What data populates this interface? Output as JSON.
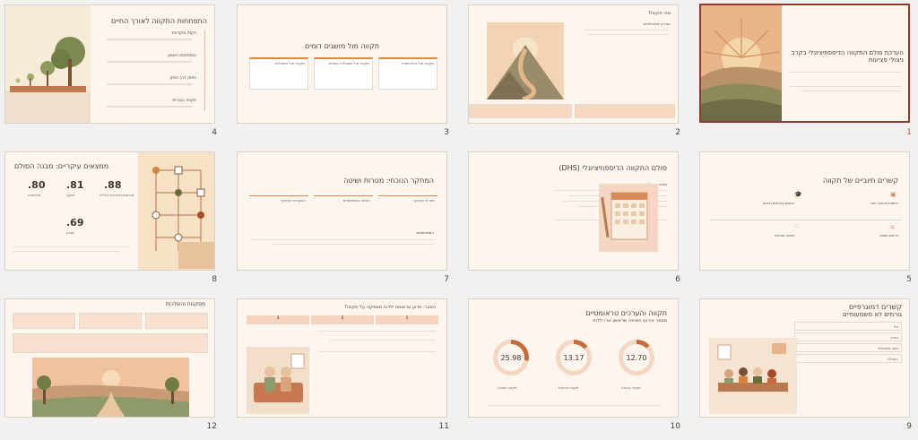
{
  "slides": [
    {
      "num": "1",
      "title": "הערכת סולם התקווה הדיספוזיציונלי בקרב ניצולי פציעות"
    },
    {
      "num": "2",
      "title": "מהי תקווה?",
      "sub": "הגדרה פסיכולוגית"
    },
    {
      "num": "3",
      "title": "תקווה מול מושגים דומים",
      "cards": [
        "תקווה מול אופטימיות",
        "תקווה מול מסוגלות עצמית",
        "תקווה מול משאלות"
      ]
    },
    {
      "num": "4",
      "title": "התפתחות התקווה לאורך החיים",
      "items": [
        "ינקות מוקדמת",
        "התפתחות האמון",
        "חיזוק דרך ניסיון",
        "תקווה בבגרות"
      ]
    },
    {
      "num": "5",
      "title": "קשרים חיוביים של תקווה",
      "items": [
        "התמודדות טובה יותר",
        "הישגים אקדמיים גבוהים",
        "בריאות נפשית",
        "תמיכה חברתית"
      ]
    },
    {
      "num": "6",
      "title": "סולם התקווה הדיספוזיציונלי (DHS)",
      "sub": "מבנה השאלון"
    },
    {
      "num": "7",
      "title": "המחקר הנוכחי: מטרות ושיטה",
      "cards": [
        "מטרת המחקר",
        "הנחת המשתתפים",
        "השערות המחקר"
      ],
      "sub": "המשתתפים"
    },
    {
      "num": "8",
      "title": "ממצאים עיקריים: מבנה הסולם",
      "stats": [
        {
          "v": ".80",
          "l": "מהימנות"
        },
        {
          "v": ".81",
          "l": "תוקף"
        },
        {
          "v": ".88",
          "l": "מהימנות פנימית כוללת"
        },
        {
          "v": ".69",
          "l": "מבחן"
        }
      ]
    },
    {
      "num": "9",
      "title": "קשרים דמוגרפיים",
      "sub": "גורמים לא משמעותיים",
      "items": [
        "גיל",
        "מגדר",
        "מצב משפחתי",
        "השכלה"
      ]
    },
    {
      "num": "10",
      "title": "תקווה והערכים טראומטיים",
      "sub": "מספר אירועי חשיפה שראשון שרו ילדות",
      "donuts": [
        {
          "v": "25.98",
          "l": "תקווה נמוכה"
        },
        {
          "v": "13.17",
          "l": "תקווה בינונית"
        },
        {
          "v": "12.70",
          "l": "תקווה גבוהה"
        }
      ]
    },
    {
      "num": "11",
      "title": "הסבר: מדוע טראומת ילדות משפיעה על תקווה?",
      "steps": [
        "1",
        "2",
        "3"
      ]
    },
    {
      "num": "12",
      "title": "מסקנות והשלכות"
    }
  ]
}
